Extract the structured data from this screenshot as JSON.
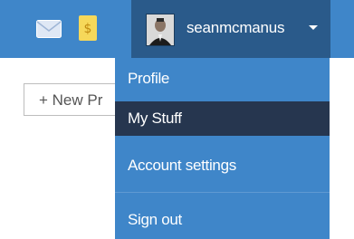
{
  "topbar": {
    "icons": [
      "mail-icon",
      "money-icon"
    ],
    "colors": {
      "bar": "#3f86c9",
      "user_menu": "#2a5a8a",
      "active_item": "#26364f"
    }
  },
  "user": {
    "username": "seanmcmanus",
    "avatar_icon": "avatar-icon",
    "caret_icon": "caret-down-icon"
  },
  "toolbar": {
    "new_project_label": "+ New Pr"
  },
  "dropdown": {
    "items": [
      {
        "label": "Profile"
      },
      {
        "label": "My Stuff",
        "active": true
      },
      {
        "label": "Account settings"
      },
      {
        "label": "Sign out"
      }
    ]
  }
}
